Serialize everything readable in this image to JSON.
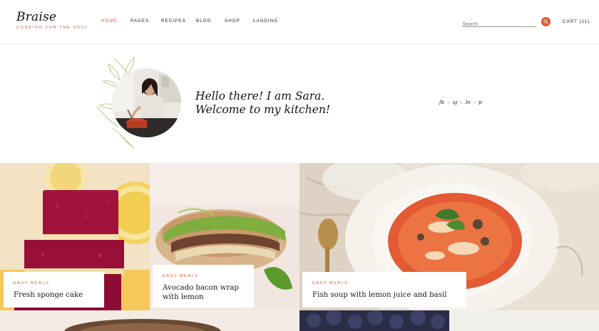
{
  "brand": {
    "name": "Braise",
    "tagline": "COOKING FOR THE SOUL",
    "accent_color": "#e0572f"
  },
  "nav": {
    "items": [
      {
        "label": "HOME",
        "active": true
      },
      {
        "label": "PAGES",
        "active": false
      },
      {
        "label": "RECIPES",
        "active": false
      },
      {
        "label": "BLOG",
        "active": false
      },
      {
        "label": "SHOP",
        "active": false
      },
      {
        "label": "LANDING",
        "active": false
      }
    ]
  },
  "search": {
    "placeholder": "Search",
    "icon": "search-icon"
  },
  "cart": {
    "label": "CART (11)"
  },
  "hero": {
    "greeting_line1": "Hello there! I am Sara.",
    "greeting_line2": "Welcome to my kitchen!",
    "social": [
      "fb",
      "ig",
      "ln",
      "p"
    ],
    "social_separator": "–"
  },
  "posts": [
    {
      "category": "EASY MEALS",
      "title": "Fresh sponge cake"
    },
    {
      "category": "EASY MEALS",
      "title": "Avocado bacon wrap with lemon"
    },
    {
      "category": "EASY MEALS",
      "title": "Fish soup with lemon juice and basil"
    }
  ]
}
